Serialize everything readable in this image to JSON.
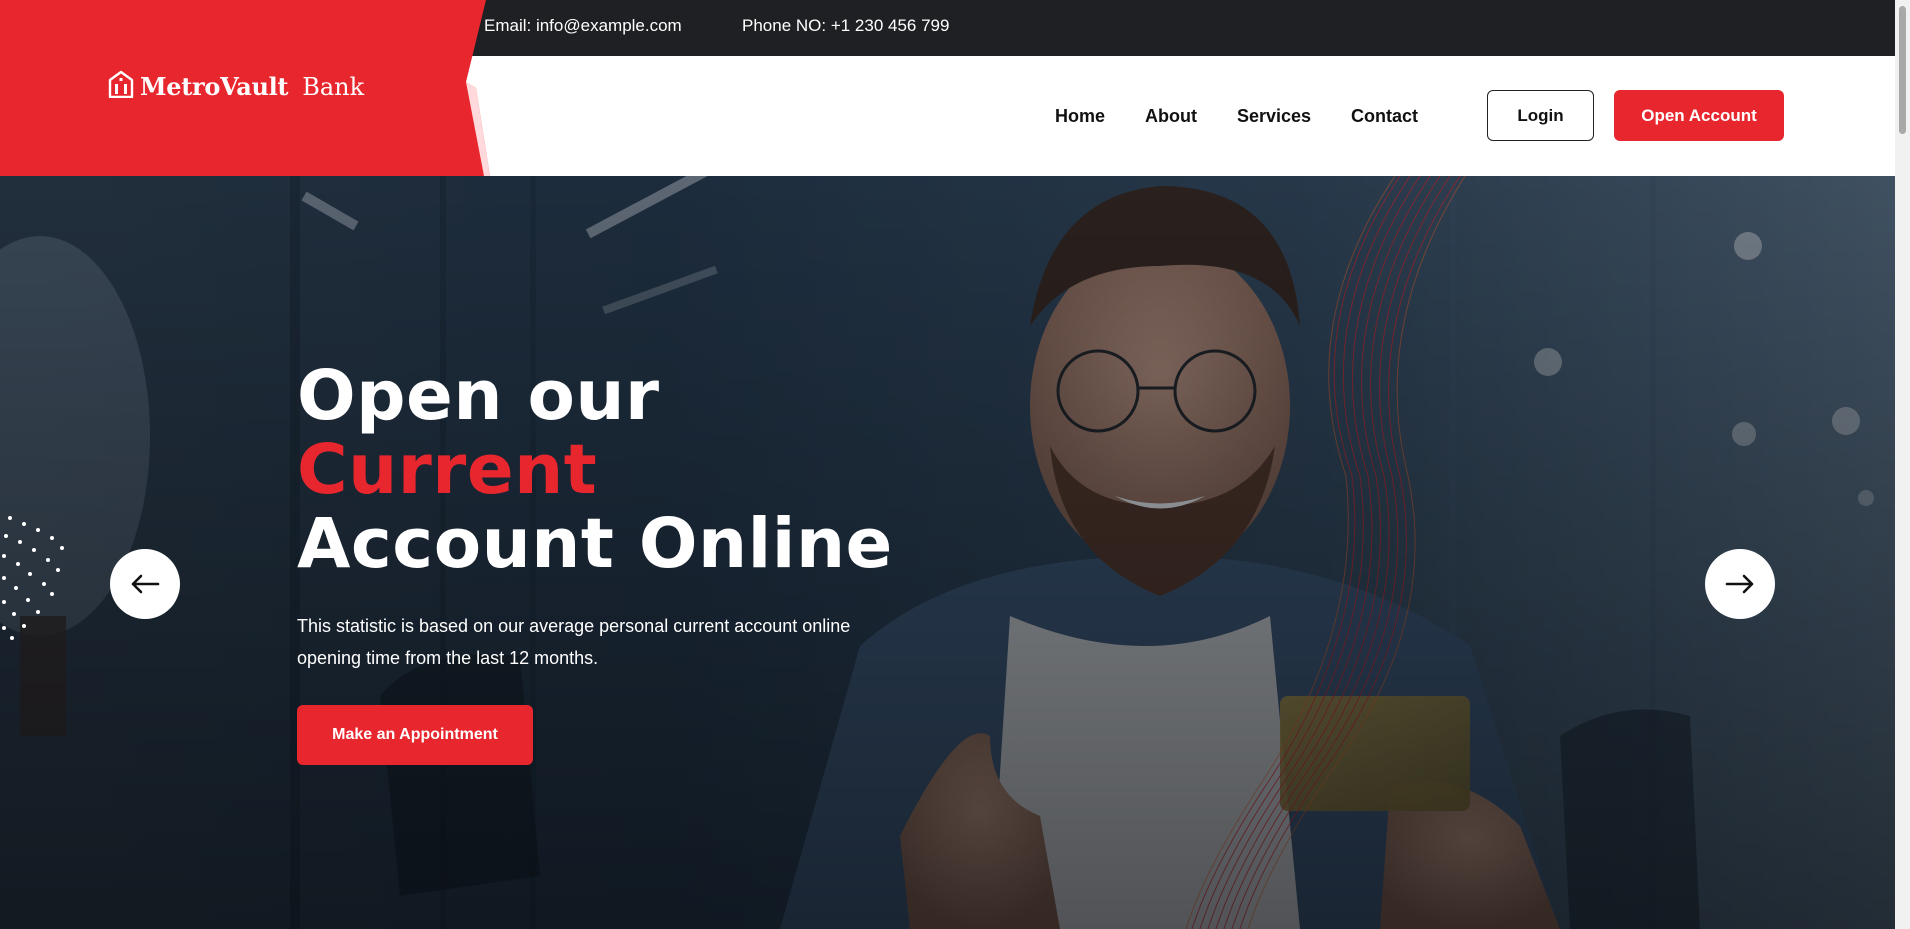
{
  "topbar": {
    "email": "Email: info@example.com",
    "phone": "Phone NO: +1 230 456 799"
  },
  "brand": {
    "name_strong": "MetroVault",
    "name_light": "Bank",
    "icon": "bank-building-icon"
  },
  "nav": {
    "items": [
      {
        "label": "Home"
      },
      {
        "label": "About"
      },
      {
        "label": "Services"
      },
      {
        "label": "Contact"
      }
    ]
  },
  "header_buttons": {
    "login": "Login",
    "open_account": "Open Account"
  },
  "hero": {
    "title_line1": "Open our",
    "title_accent": "Current",
    "title_line3": "Account Online",
    "description": "This statistic is based on our average personal current account online opening time from the last 12 months.",
    "cta": "Make an Appointment",
    "prev_icon": "arrow-left-icon",
    "next_icon": "arrow-right-icon"
  },
  "colors": {
    "accent": "#e8262e",
    "dark": "#1f2024",
    "white": "#ffffff"
  }
}
